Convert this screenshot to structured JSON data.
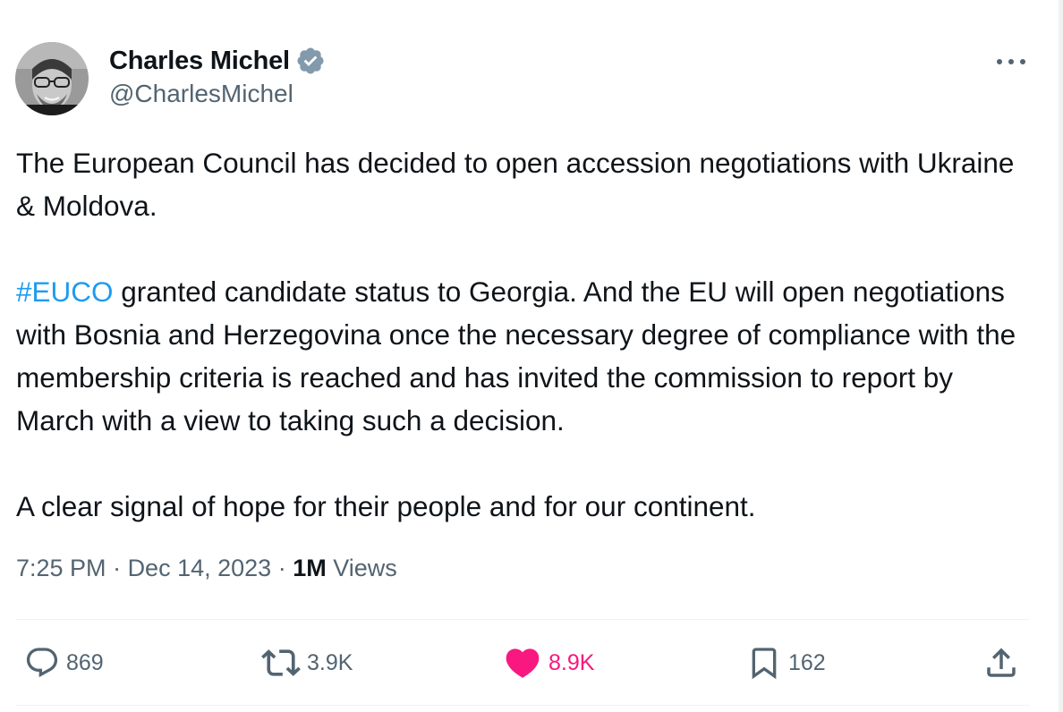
{
  "author": {
    "display_name": "Charles Michel",
    "handle": "@CharlesMichel",
    "verified": true,
    "avatar_icon": "profile-photo"
  },
  "tweet": {
    "paragraph1": "The European Council has decided to open accession negotiations with Ukraine & Moldova.",
    "hashtag": "#EUCO",
    "paragraph2_rest": " granted candidate status to Georgia. And the EU will open negotiations with Bosnia and Herzegovina once the necessary degree of compliance with the membership criteria  is reached and has invited the commission to report by March with a view to taking such a decision.",
    "paragraph3": "A clear signal of hope for their people and for our continent."
  },
  "meta": {
    "time": "7:25 PM",
    "separator": " · ",
    "date": "Dec 14, 2023",
    "views_count": "1M",
    "views_label": " Views"
  },
  "actions": {
    "replies": "869",
    "reposts": "3.9K",
    "likes": "8.9K",
    "bookmarks": "162"
  },
  "colors": {
    "text": "#0f1419",
    "secondary": "#536471",
    "link": "#1d9bf0",
    "like": "#f91880",
    "verified_badge": "#829aab",
    "divider": "#eff3f4"
  }
}
